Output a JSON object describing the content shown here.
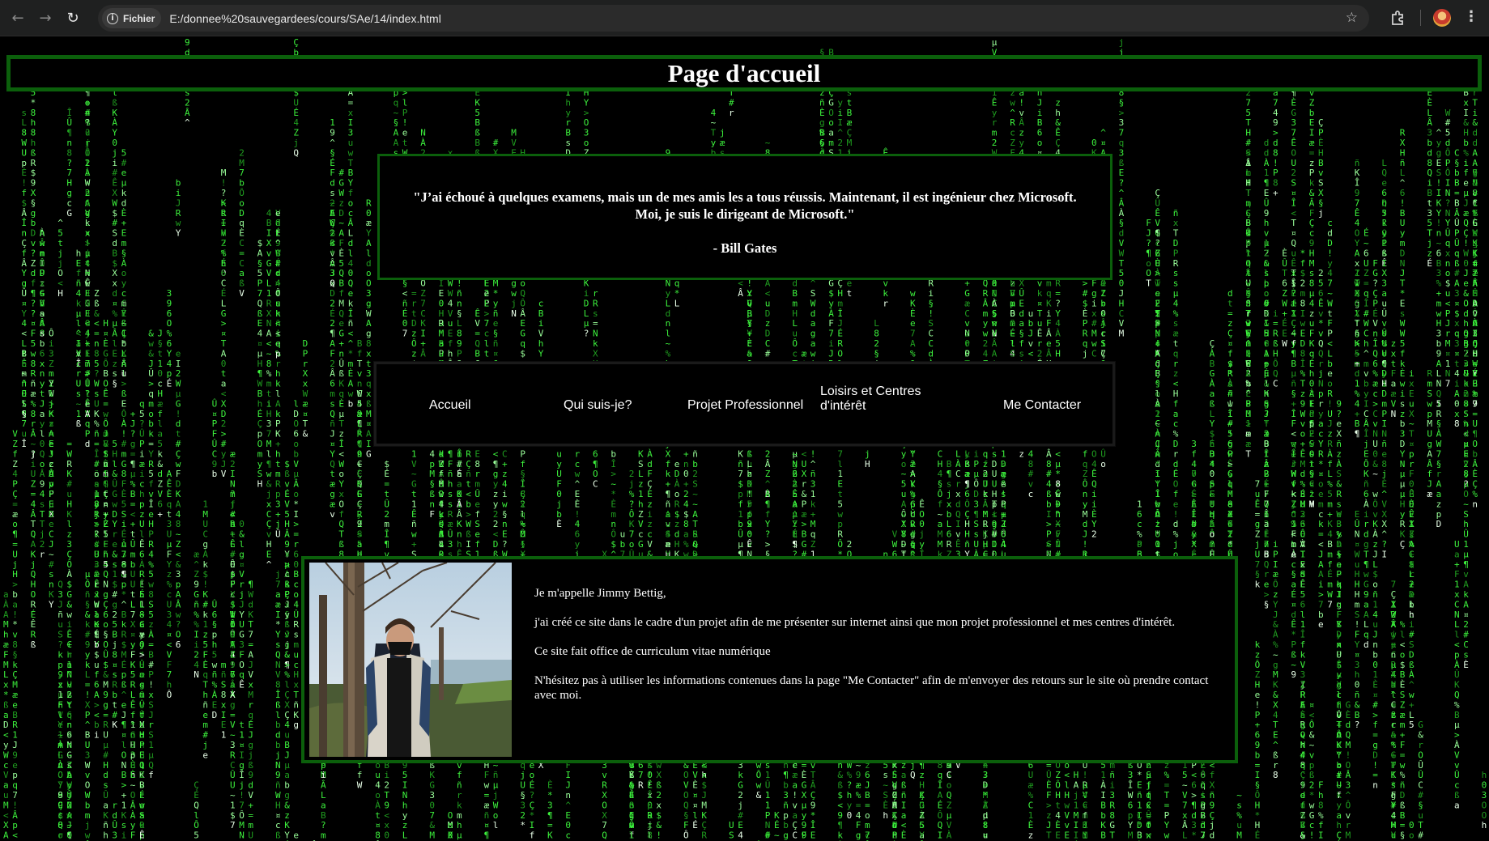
{
  "browser": {
    "url": "E:/donnee%20sauvegardees/cours/SAe/14/index.html",
    "site_info_label": "Fichier",
    "back_glyph": "←",
    "forward_glyph": "→",
    "reload_glyph": "↻",
    "star_glyph": "☆",
    "menu_glyph": "⋮",
    "icons": [
      "back-arrow-icon",
      "forward-arrow-icon",
      "reload-icon",
      "info-icon",
      "star-icon",
      "extensions-icon",
      "profile-avatar-icon",
      "menu-icon"
    ]
  },
  "header": {
    "title": "Page d'accueil"
  },
  "quote": {
    "line1": "\"J’ai échoué à quelques examens, mais un de mes amis les a tous réussis. Maintenant, il est ingénieur chez Microsoft.",
    "line2": "Moi, je suis le dirigeant de Microsoft.\"",
    "author": "- Bill Gates"
  },
  "nav": {
    "items": [
      {
        "label": "Accueil"
      },
      {
        "label": "Qui suis-je?"
      },
      {
        "label": "Projet Professionnel"
      },
      {
        "label": "Loisirs et Centres d'intérêt"
      },
      {
        "label": "Me Contacter"
      }
    ]
  },
  "intro": {
    "paragraphs": [
      "Je m'appelle Jimmy Bettig,",
      "j'ai créé ce site dans le cadre d'un projet afin de me présenter sur internet ainsi que mon projet professionnel et mes centres d'intérêt.",
      "Ce site fait office de curriculum vitae numérique",
      "N'hésitez pas à utiliser les informations contenues dans la page \"Me Contacter\" afin de m'envoyer des retours sur le site où prendre contact avec moi."
    ]
  },
  "colors": {
    "border_green": "#0b5f0b",
    "rain_green": "#3cf03c",
    "rain_dim": "#1f9d1f",
    "background": "#000000",
    "chrome": "#1f2020"
  }
}
